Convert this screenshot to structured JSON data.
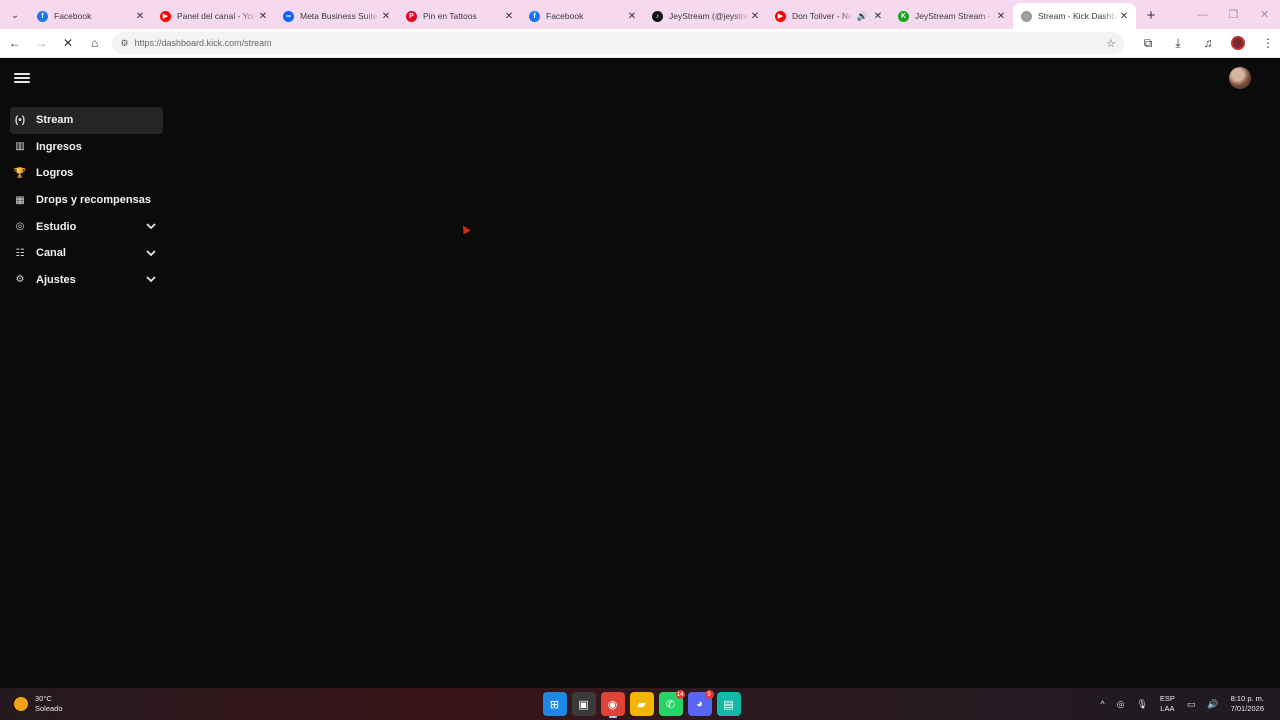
{
  "browser": {
    "tabs": [
      {
        "title": "Facebook",
        "favicon": "facebook-icon",
        "color": "#1877f2",
        "glyph": "f"
      },
      {
        "title": "Panel del canal - YouTube",
        "favicon": "youtube-icon",
        "color": "#ff0000",
        "glyph": "▶"
      },
      {
        "title": "Meta Business Suite",
        "favicon": "meta-icon",
        "color": "#0866ff",
        "glyph": "∞"
      },
      {
        "title": "Pin en Tattoos",
        "favicon": "pinterest-icon",
        "color": "#e60023",
        "glyph": "P"
      },
      {
        "title": "Facebook",
        "favicon": "facebook-icon",
        "color": "#1877f2",
        "glyph": "f"
      },
      {
        "title": "JeyStream (@jeystream)",
        "favicon": "tiktok-icon",
        "color": "#111111",
        "glyph": "♪"
      },
      {
        "title": "Don Toliver - No",
        "favicon": "youtube-icon",
        "color": "#ff0000",
        "glyph": "▶",
        "audio": true
      },
      {
        "title": "JeyStream Stream - Kick",
        "favicon": "kick-icon",
        "color": "#1aa31a",
        "glyph": "K"
      },
      {
        "title": "Stream - Kick Dashboard",
        "favicon": "loading-icon",
        "color": "#9a9a9a",
        "glyph": "◌",
        "active": true
      }
    ],
    "url": "https://dashboard.kick.com/stream"
  },
  "sidebar": {
    "items": [
      {
        "label": "Stream",
        "icon": "broadcast-icon",
        "glyph": "(•)",
        "active": true,
        "expandable": false
      },
      {
        "label": "Ingresos",
        "icon": "chart-icon",
        "glyph": "▥",
        "active": false,
        "expandable": false
      },
      {
        "label": "Logros",
        "icon": "trophy-icon",
        "glyph": "🏆",
        "active": false,
        "expandable": false
      },
      {
        "label": "Drops y recompensas",
        "icon": "drops-icon",
        "glyph": "▦",
        "active": false,
        "expandable": false
      },
      {
        "label": "Estudio",
        "icon": "studio-icon",
        "glyph": "◎",
        "active": false,
        "expandable": true
      },
      {
        "label": "Canal",
        "icon": "channel-icon",
        "glyph": "☷",
        "active": false,
        "expandable": true
      },
      {
        "label": "Ajustes",
        "icon": "gear-icon",
        "glyph": "⚙",
        "active": false,
        "expandable": true
      }
    ]
  },
  "taskbar": {
    "weather_temp": "30°C",
    "weather_desc": "Soleado",
    "apps": [
      {
        "name": "windows-start-icon",
        "color": "#1e88e5",
        "glyph": "⊞"
      },
      {
        "name": "task-view-icon",
        "color": "#3a3a3a",
        "glyph": "▣"
      },
      {
        "name": "chrome-icon",
        "color": "#db4437",
        "glyph": "◉",
        "active": true
      },
      {
        "name": "file-explorer-icon",
        "color": "#f4b400",
        "glyph": "▰"
      },
      {
        "name": "whatsapp-icon",
        "color": "#25d366",
        "glyph": "✆",
        "badge": "14"
      },
      {
        "name": "discord-icon",
        "color": "#5865f2",
        "glyph": "◕",
        "badge": "9"
      },
      {
        "name": "chat-app-icon",
        "color": "#14b8a6",
        "glyph": "▤"
      }
    ],
    "lang_top": "ESP",
    "lang_bottom": "LAA",
    "time": "8:10 p. m.",
    "date": "7/01/2026"
  }
}
